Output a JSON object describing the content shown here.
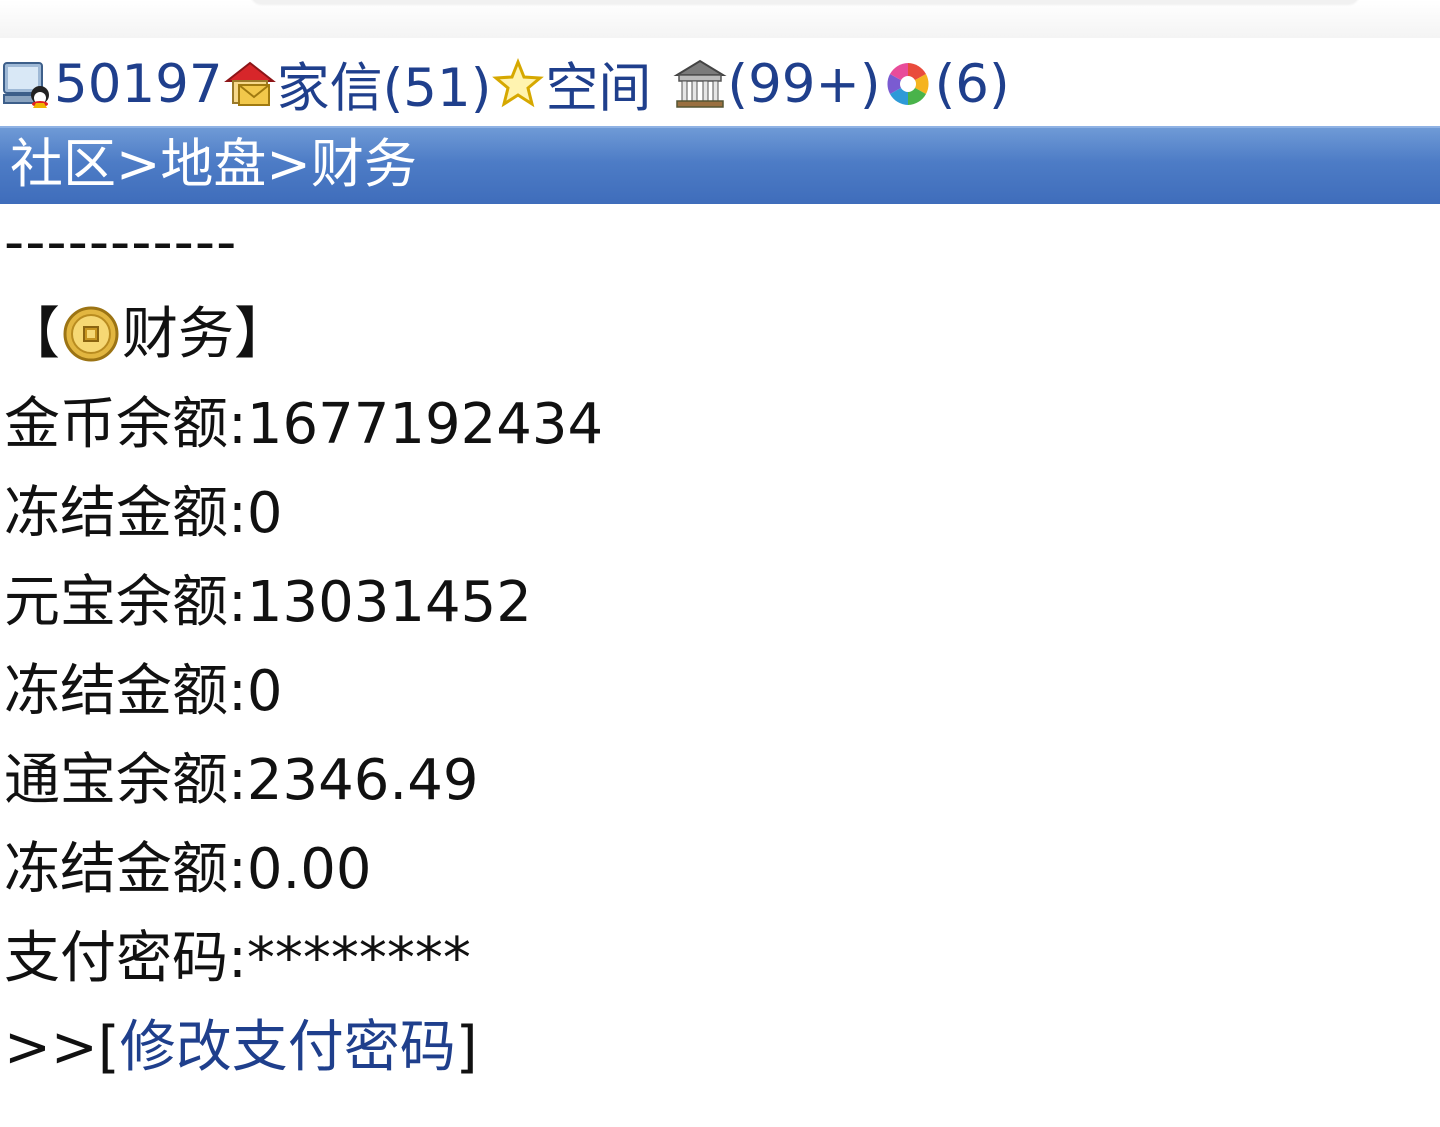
{
  "status_bar": {
    "user_count": "50197",
    "mail_label": "家信(51)",
    "space_label": "空间",
    "building_count": "(99+)",
    "circle_count": "(6)"
  },
  "breadcrumb": {
    "community": "社区",
    "territory": "地盘",
    "finance": "财务",
    "separator": ">"
  },
  "divider": "-----------",
  "section": {
    "open_bracket": "【",
    "title": "财务",
    "close_bracket": "】"
  },
  "finance_rows": [
    {
      "label": "金币余额:",
      "value": "1677192434"
    },
    {
      "label": "冻结金额:",
      "value": "0"
    },
    {
      "label": "元宝余额:",
      "value": "13031452"
    },
    {
      "label": "冻结金额:",
      "value": "0"
    },
    {
      "label": "通宝余额:",
      "value": "2346.49"
    },
    {
      "label": "冻结金额:",
      "value": "0.00"
    },
    {
      "label": "支付密码:",
      "value": "********"
    }
  ],
  "change_password": {
    "prefix": ">>[",
    "label": "修改支付密码",
    "suffix": "]"
  },
  "icons": {
    "user": "user-computer-icon",
    "mail": "house-mail-icon",
    "space": "star-icon",
    "building": "building-icon",
    "circle": "color-wheel-icon",
    "coin": "gold-coin-icon"
  },
  "colors": {
    "link": "#1f3f8c",
    "header_bar": "#4d7cc6"
  }
}
